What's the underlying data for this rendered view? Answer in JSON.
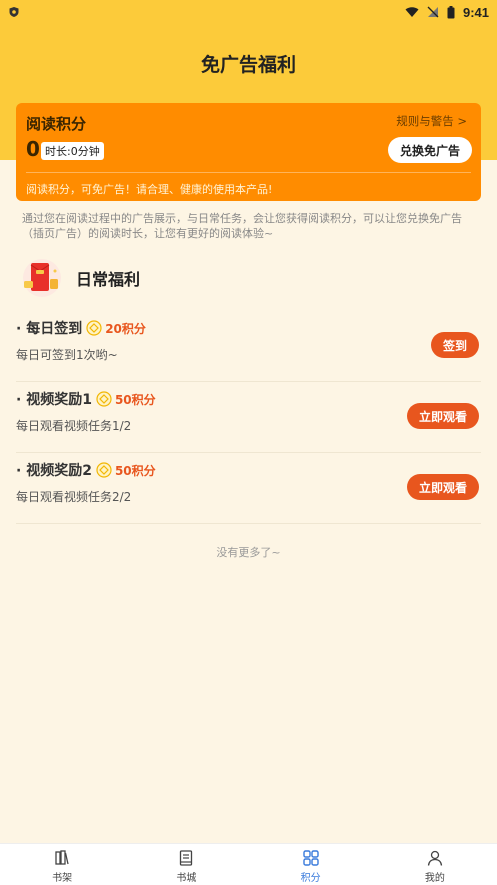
{
  "status_bar": {
    "time": "9:41"
  },
  "page": {
    "title": "免广告福利"
  },
  "points_card": {
    "title": "阅读积分",
    "rules_link": "规则与警告 >",
    "value": "0",
    "duration": "时长:0分钟",
    "redeem_button": "兑换免广告",
    "note": "阅读积分，可免广告！请合理、健康的使用本产品!"
  },
  "description": "通过您在阅读过程中的广告展示，与日常任务，会让您获得阅读积分，可以让您兑换免广告（插页广告）的阅读时长，让您有更好的阅读体验~",
  "daily": {
    "title": "日常福利",
    "tasks": [
      {
        "name": "· 每日签到",
        "points": "20积分",
        "desc": "每日可签到1次哟~",
        "button": "签到"
      },
      {
        "name": "· 视频奖励1",
        "points": "50积分",
        "desc": "每日观看视频任务1/2",
        "button": "立即观看"
      },
      {
        "name": "· 视频奖励2",
        "points": "50积分",
        "desc": "每日观看视频任务2/2",
        "button": "立即观看"
      }
    ]
  },
  "footer_note": "没有更多了~",
  "tabs": [
    {
      "label": "书架",
      "icon": "bookshelf-icon"
    },
    {
      "label": "书城",
      "icon": "book-icon"
    },
    {
      "label": "积分",
      "icon": "grid-icon"
    },
    {
      "label": "我的",
      "icon": "user-icon"
    }
  ],
  "colors": {
    "header": "#fccb3a",
    "card": "#ff8c00",
    "accent": "#e8561e",
    "active_tab": "#3a7bdc",
    "background": "#fdf5e4"
  }
}
